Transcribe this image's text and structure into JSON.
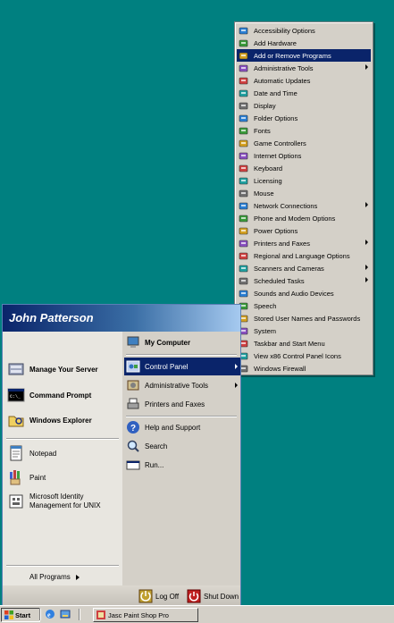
{
  "control_panel_menu": {
    "items": [
      {
        "label": "Accessibility Options",
        "icon": "accessibility-icon",
        "submenu": false,
        "selected": false
      },
      {
        "label": "Add Hardware",
        "icon": "add-hardware-icon",
        "submenu": false,
        "selected": false
      },
      {
        "label": "Add or Remove Programs",
        "icon": "add-remove-programs-icon",
        "submenu": false,
        "selected": true
      },
      {
        "label": "Administrative Tools",
        "icon": "administrative-tools-icon",
        "submenu": true,
        "selected": false
      },
      {
        "label": "Automatic Updates",
        "icon": "automatic-updates-icon",
        "submenu": false,
        "selected": false
      },
      {
        "label": "Date and Time",
        "icon": "date-time-icon",
        "submenu": false,
        "selected": false
      },
      {
        "label": "Display",
        "icon": "display-icon",
        "submenu": false,
        "selected": false
      },
      {
        "label": "Folder Options",
        "icon": "folder-options-icon",
        "submenu": false,
        "selected": false
      },
      {
        "label": "Fonts",
        "icon": "fonts-icon",
        "submenu": false,
        "selected": false
      },
      {
        "label": "Game Controllers",
        "icon": "game-controllers-icon",
        "submenu": false,
        "selected": false
      },
      {
        "label": "Internet Options",
        "icon": "internet-options-icon",
        "submenu": false,
        "selected": false
      },
      {
        "label": "Keyboard",
        "icon": "keyboard-icon",
        "submenu": false,
        "selected": false
      },
      {
        "label": "Licensing",
        "icon": "licensing-icon",
        "submenu": false,
        "selected": false
      },
      {
        "label": "Mouse",
        "icon": "mouse-icon",
        "submenu": false,
        "selected": false
      },
      {
        "label": "Network Connections",
        "icon": "network-connections-icon",
        "submenu": true,
        "selected": false
      },
      {
        "label": "Phone and Modem Options",
        "icon": "phone-modem-icon",
        "submenu": false,
        "selected": false
      },
      {
        "label": "Power Options",
        "icon": "power-options-icon",
        "submenu": false,
        "selected": false
      },
      {
        "label": "Printers and Faxes",
        "icon": "printers-faxes-icon",
        "submenu": true,
        "selected": false
      },
      {
        "label": "Regional and Language Options",
        "icon": "regional-language-icon",
        "submenu": false,
        "selected": false
      },
      {
        "label": "Scanners and Cameras",
        "icon": "scanners-cameras-icon",
        "submenu": true,
        "selected": false
      },
      {
        "label": "Scheduled Tasks",
        "icon": "scheduled-tasks-icon",
        "submenu": true,
        "selected": false
      },
      {
        "label": "Sounds and Audio Devices",
        "icon": "sounds-audio-icon",
        "submenu": false,
        "selected": false
      },
      {
        "label": "Speech",
        "icon": "speech-icon",
        "submenu": false,
        "selected": false
      },
      {
        "label": "Stored User Names and Passwords",
        "icon": "stored-passwords-icon",
        "submenu": false,
        "selected": false
      },
      {
        "label": "System",
        "icon": "system-icon",
        "submenu": false,
        "selected": false
      },
      {
        "label": "Taskbar and Start Menu",
        "icon": "taskbar-start-menu-icon",
        "submenu": false,
        "selected": false
      },
      {
        "label": "View x86 Control Panel Icons",
        "icon": "x86-control-panel-icon",
        "submenu": false,
        "selected": false
      },
      {
        "label": "Windows Firewall",
        "icon": "windows-firewall-icon",
        "submenu": false,
        "selected": false
      }
    ]
  },
  "start_menu": {
    "user_name": "John Patterson",
    "left_pinned": [
      {
        "label": "Manage Your Server",
        "icon": "manage-server-icon"
      },
      {
        "label": "Command Prompt",
        "icon": "command-prompt-icon"
      },
      {
        "label": "Windows Explorer",
        "icon": "windows-explorer-icon"
      }
    ],
    "left_recent": [
      {
        "label": "Notepad",
        "icon": "notepad-icon"
      },
      {
        "label": "Paint",
        "icon": "paint-icon"
      },
      {
        "label": "Microsoft Identity\nManagement for UNIX",
        "line1": "Microsoft Identity",
        "line2": "Management for UNIX",
        "icon": "identity-management-icon"
      }
    ],
    "all_programs": "All Programs",
    "right_items": [
      {
        "label": "My Computer",
        "icon": "my-computer-icon",
        "bold": true
      },
      {
        "label": "Control Panel",
        "icon": "control-panel-icon",
        "selected": true
      },
      {
        "label": "Administrative Tools",
        "icon": "administrative-tools-icon"
      },
      {
        "label": "Printers and Faxes",
        "icon": "printers-faxes-icon"
      },
      {
        "label": "Help and Support",
        "icon": "help-icon"
      },
      {
        "label": "Search",
        "icon": "search-icon"
      },
      {
        "label": "Run...",
        "icon": "run-icon"
      }
    ],
    "log_off": "Log Off",
    "shut_down": "Shut Down"
  },
  "taskbar": {
    "start_label": "Start",
    "task_label": "Jasc Paint Shop Pro"
  },
  "colors": {
    "desktop": "#008080",
    "selection": "#0a246a",
    "menu_face": "#d4d0c8"
  }
}
